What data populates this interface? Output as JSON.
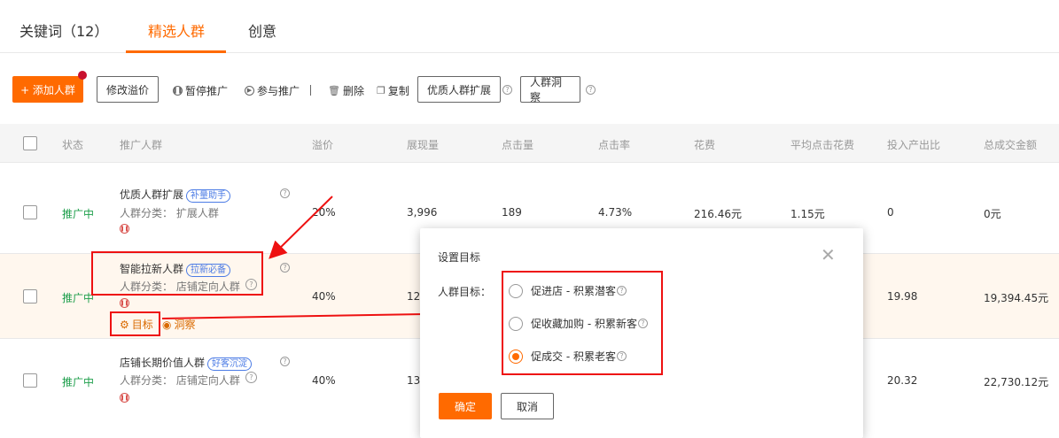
{
  "tabs": [
    {
      "label": "关键词（12）"
    },
    {
      "label": "精选人群"
    },
    {
      "label": "创意"
    }
  ],
  "toolbar": {
    "add_label": "+ 添加人群",
    "modify_premium": "修改溢价",
    "pause": "暂停推广",
    "join": "参与推广",
    "delete": "删除",
    "copy": "复制",
    "quality_expand": "优质人群扩展",
    "insight": "人群洞察"
  },
  "table": {
    "headers": [
      "状态",
      "推广人群",
      "溢价",
      "展现量",
      "点击量",
      "点击率",
      "花费",
      "平均点击花费",
      "投入产出比",
      "总成交金额"
    ],
    "rows": [
      {
        "status": "推广中",
        "name": "优质人群扩展",
        "tag": "补量助手",
        "category": "人群分类： 扩展人群",
        "premium": "20%",
        "impressions": "3,996",
        "clicks": "189",
        "ctr": "4.73%",
        "cost": "216.46元",
        "cpc": "1.15元",
        "roi": "0",
        "gmv": "0元"
      },
      {
        "status": "推广中",
        "name": "智能拉新人群",
        "tag": "拉新必备",
        "category": "人群分类： 店铺定向人群",
        "premium": "40%",
        "impressions": "12,",
        "roi": "19.98",
        "gmv": "19,394.45元",
        "link_target": "目标",
        "link_insight": "洞察"
      },
      {
        "status": "推广中",
        "name": "店铺长期价值人群",
        "tag": "好客沉淀",
        "category": "人群分类： 店铺定向人群",
        "premium": "40%",
        "impressions": "13,",
        "roi": "20.32",
        "gmv": "22,730.12元"
      }
    ]
  },
  "modal": {
    "title": "设置目标",
    "field_label": "人群目标：",
    "options": [
      {
        "label": "促进店 - 积累潜客",
        "selected": false
      },
      {
        "label": "促收藏加购 - 积累新客",
        "selected": false
      },
      {
        "label": "促成交 - 积累老客",
        "selected": true
      }
    ],
    "ok": "确定",
    "cancel": "取消"
  },
  "colors": {
    "accent": "#ff6a00",
    "status_green": "#1c9e4a",
    "annotation_red": "#ee1111",
    "tag_blue": "#4b7be5"
  }
}
